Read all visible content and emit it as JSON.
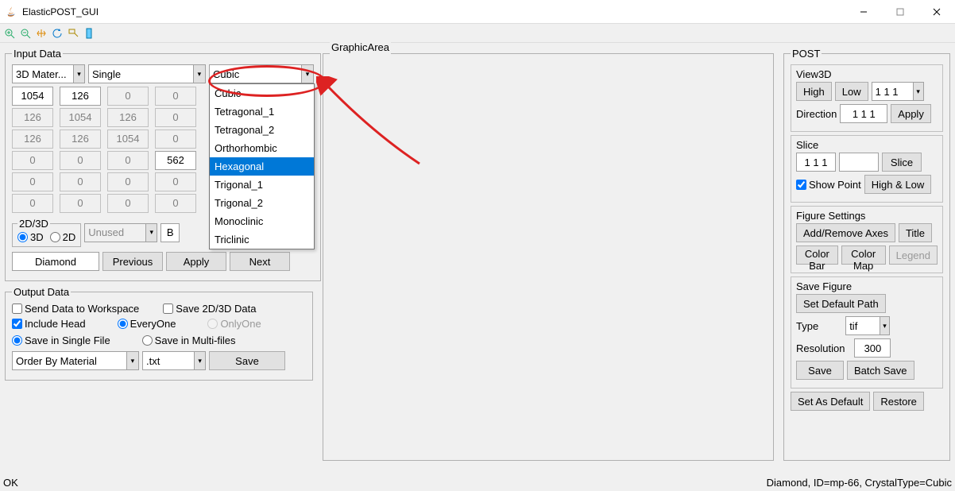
{
  "window": {
    "title": "ElasticPOST_GUI"
  },
  "toolbar_icons": [
    "zoom-in",
    "zoom-out",
    "pan",
    "rotate",
    "datacursor",
    "pick",
    "preview"
  ],
  "inputData": {
    "legend": "Input Data",
    "materialSel": "3D Mater...",
    "modeSel": "Single",
    "crystalSel": "Cubic",
    "crystalOptions": [
      "Cubic",
      "Tetragonal_1",
      "Tetragonal_2",
      "Orthorhombic",
      "Hexagonal",
      "Trigonal_1",
      "Trigonal_2",
      "Monoclinic",
      "Triclinic"
    ],
    "highlighted": "Hexagonal",
    "matrix": [
      [
        "1054",
        "126",
        "0",
        "0"
      ],
      [
        "126",
        "1054",
        "126",
        "0"
      ],
      [
        "126",
        "126",
        "1054",
        "0"
      ],
      [
        "0",
        "0",
        "0",
        "562"
      ],
      [
        "0",
        "0",
        "0",
        "0"
      ],
      [
        "0",
        "0",
        "0",
        "0"
      ]
    ],
    "editable": [
      [
        true,
        true,
        false,
        false
      ],
      [
        false,
        false,
        false,
        false
      ],
      [
        false,
        false,
        false,
        false
      ],
      [
        false,
        false,
        false,
        true
      ],
      [
        false,
        false,
        false,
        false
      ],
      [
        false,
        false,
        false,
        false
      ]
    ],
    "dim": {
      "legend": "2D/3D",
      "r3d": "3D",
      "r2d": "2D",
      "unused": "Unused",
      "b": "B"
    },
    "material": "Diamond",
    "btnPrev": "Previous",
    "btnApply": "Apply",
    "btnNext": "Next"
  },
  "outputData": {
    "legend": "Output Data",
    "sendWs": "Send Data to Workspace",
    "save23d": "Save 2D/3D Data",
    "includeHead": "Include Head",
    "everyone": "EveryOne",
    "onlyone": "OnlyOne",
    "singleFile": "Save in Single File",
    "multiFiles": "Save in Multi-files",
    "orderBy": "Order By Material",
    "ext": ".txt",
    "save": "Save"
  },
  "graphicArea": {
    "legend": "GraphicArea"
  },
  "post": {
    "legend": "POST",
    "view3d": {
      "legend": "View3D",
      "high": "High",
      "low": "Low",
      "vec": "1 1 1",
      "dir": "Direction",
      "dirv": "1 1 1",
      "apply": "Apply"
    },
    "slice": {
      "legend": "Slice",
      "vec": "1 1 1",
      "btn": "Slice",
      "show": "Show Point",
      "hl": "High & Low"
    },
    "fig": {
      "legend": "Figure Settings",
      "axes": "Add/Remove Axes",
      "title": "Title",
      "cb": "Color Bar",
      "cm": "Color Map",
      "leg": "Legend"
    },
    "savefig": {
      "legend": "Save Figure",
      "setdef": "Set Default Path",
      "type": "Type",
      "typev": "tif",
      "res": "Resolution",
      "resv": "300",
      "save": "Save",
      "batch": "Batch Save"
    },
    "setdef": "Set As Default",
    "restore": "Restore"
  },
  "status": {
    "ok": "OK",
    "right": "Diamond, ID=mp-66, CrystalType=Cubic"
  }
}
